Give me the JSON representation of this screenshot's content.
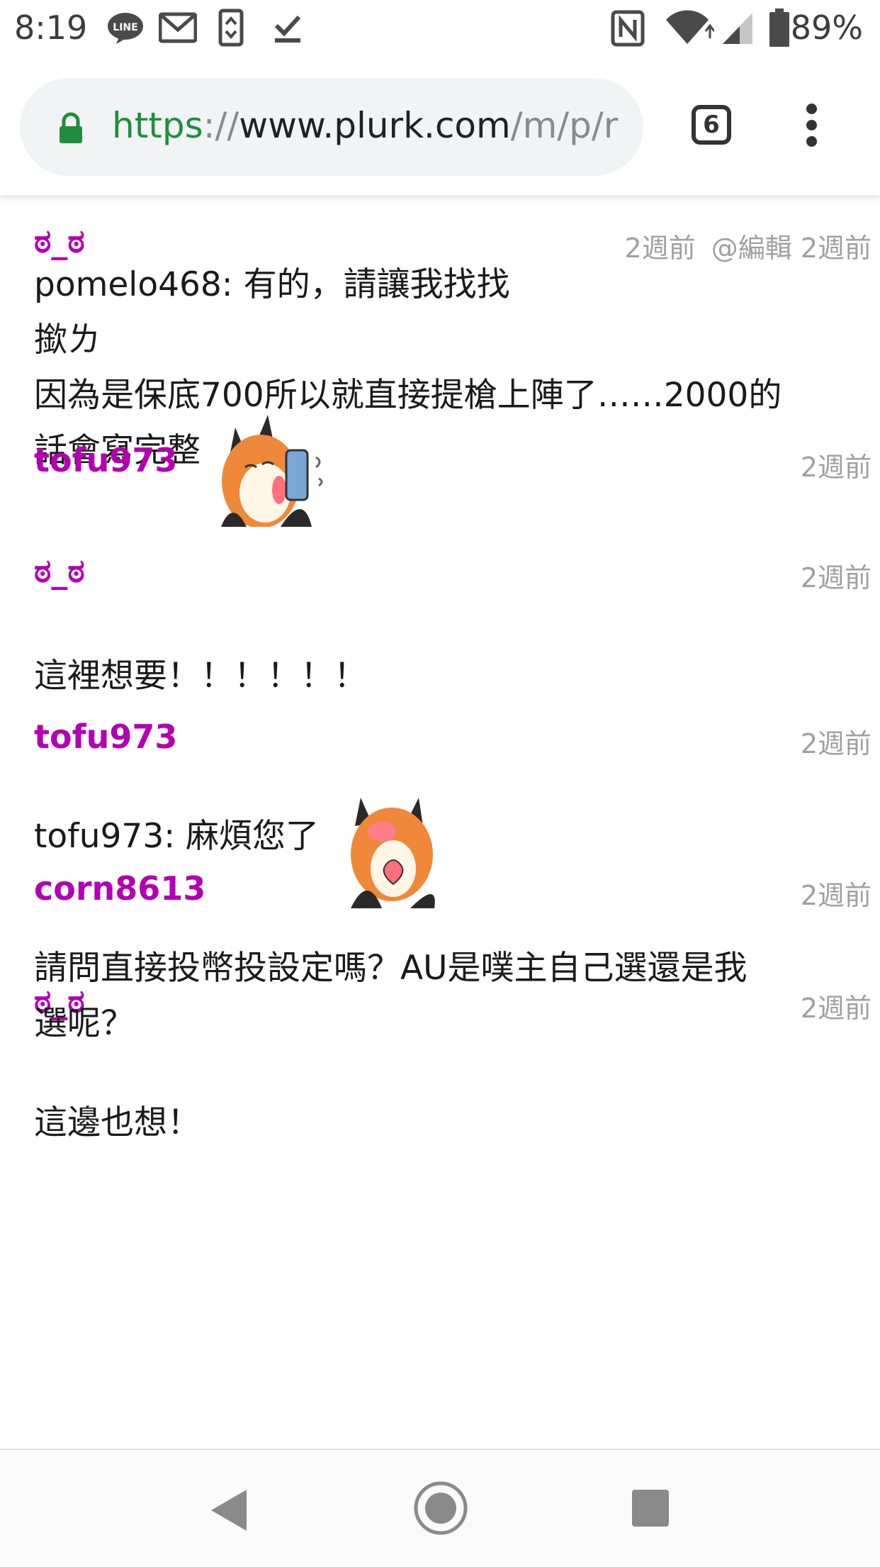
{
  "status_bar": {
    "time": "8:19",
    "notification_icons": [
      "line-icon",
      "gmail-icon",
      "sync-icon",
      "download-done-icon"
    ],
    "system_icons": [
      "nfc-icon",
      "wifi-icon",
      "signal-icon",
      "battery-icon"
    ],
    "battery_percent": "89%"
  },
  "browser": {
    "url_scheme": "https",
    "url_sep": "://",
    "url_host": "www.plurk.com",
    "url_path": "/m/p/r",
    "tab_count": "6"
  },
  "responses": [
    {
      "user": "ಠ_ಠ",
      "time": "2週前",
      "edited": "@編輯 2週前",
      "lines": [
        "pomelo468: 有的，請讓我找找",
        "撳ㄌ",
        "因為是保底700所以就直接提槍上陣了……2000的",
        "話會寫完整"
      ],
      "emoticon": "fox-phone-emoticon"
    },
    {
      "user": "tofu973",
      "time": "2週前",
      "lines": [
        "這裡想要！！！！！！"
      ]
    },
    {
      "user": "ಠ_ಠ",
      "time": "2週前",
      "lines": [
        "tofu973: 麻煩您了"
      ],
      "emoticon": "fox-love-emoticon"
    },
    {
      "user": "tofu973",
      "time": "2週前",
      "lines": [
        "請問直接投幣投設定嗎？AU是噗主自己選還是我",
        "選呢？"
      ]
    },
    {
      "user": "corn8613",
      "time": "2週前",
      "lines": [
        "這邊也想！"
      ]
    },
    {
      "user": "ಠ_ಠ",
      "time": "2週前",
      "lines": []
    }
  ],
  "colors": {
    "username": "#b200b2",
    "timestamp": "#a0a0a0",
    "secure_scheme": "#1e8e3e",
    "text": "#1a1a1a"
  }
}
